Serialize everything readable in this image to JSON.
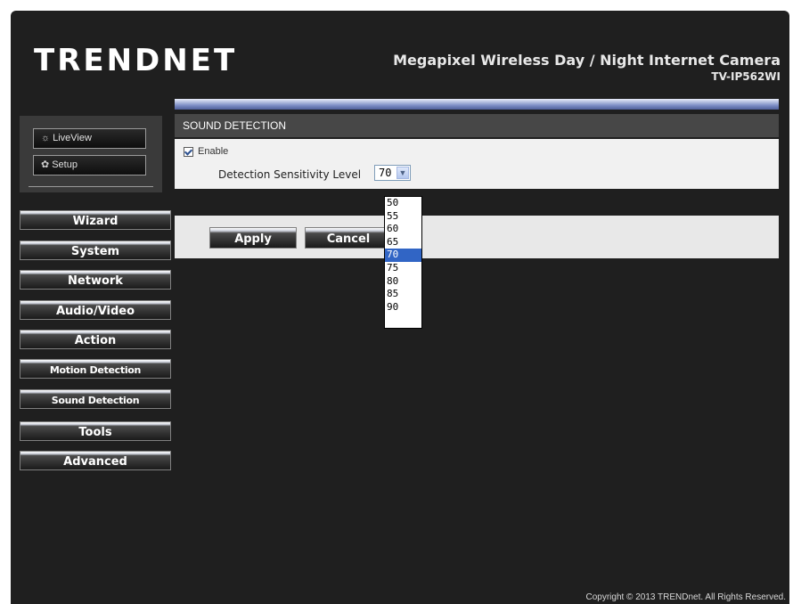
{
  "header": {
    "logo": "TRENDNET",
    "product_title": "Megapixel Wireless Day / Night Internet Camera",
    "model": "TV-IP562WI"
  },
  "mode": {
    "liveview_label": "LiveView",
    "setup_label": "Setup"
  },
  "menu": [
    {
      "label": "Wizard"
    },
    {
      "label": "System"
    },
    {
      "label": "Network"
    },
    {
      "label": "Audio/Video"
    },
    {
      "label": "Action"
    },
    {
      "label": "Motion Detection"
    },
    {
      "label": "Sound Detection"
    },
    {
      "label": "Tools"
    },
    {
      "label": "Advanced"
    }
  ],
  "section": {
    "title": "SOUND DETECTION",
    "enable_label": "Enable",
    "enable_checked": true,
    "sensitivity_label": "Detection Sensitivity Level",
    "sensitivity_value": "70",
    "options": [
      "50",
      "55",
      "60",
      "65",
      "70",
      "75",
      "80",
      "85",
      "90"
    ],
    "selected_option": "70"
  },
  "actions": {
    "apply_label": "Apply",
    "cancel_label": "Cancel"
  },
  "footer": {
    "copyright": "Copyright © 2013 TRENDnet. All Rights Reserved."
  },
  "colors": {
    "background": "#1f1f1f",
    "accent_blue": "#7e8fc6",
    "selected_option": "#3165c5"
  }
}
